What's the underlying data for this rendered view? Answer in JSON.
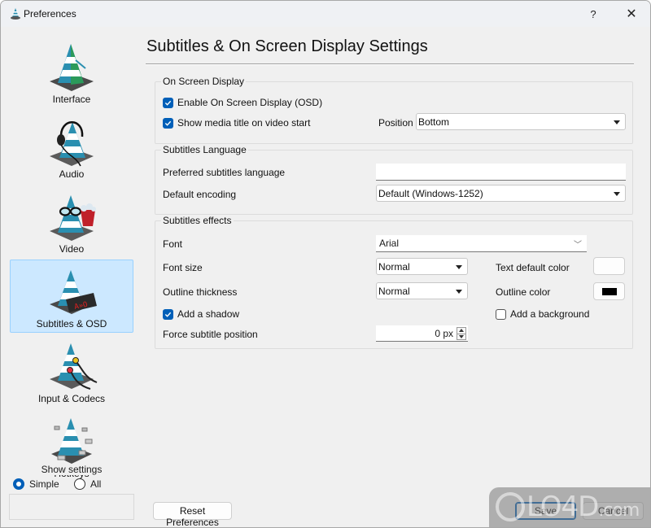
{
  "window": {
    "title": "Preferences",
    "help_label": "?",
    "close_label": "✕"
  },
  "sidebar": {
    "items": [
      {
        "label": "Interface",
        "icon": "vlc-cone-interface-icon",
        "selected": false
      },
      {
        "label": "Audio",
        "icon": "vlc-cone-headphones-icon",
        "selected": false
      },
      {
        "label": "Video",
        "icon": "vlc-cone-glasses-popcorn-icon",
        "selected": false
      },
      {
        "label": "Subtitles & OSD",
        "icon": "vlc-cone-osd-display-icon",
        "selected": true
      },
      {
        "label": "Input & Codecs",
        "icon": "vlc-cone-cables-icon",
        "selected": false
      },
      {
        "label": "Hotkeys",
        "icon": "vlc-cone-keys-icon",
        "selected": false
      }
    ],
    "show_settings": {
      "title": "Show settings",
      "options": [
        {
          "label": "Simple",
          "checked": true
        },
        {
          "label": "All",
          "checked": false
        }
      ]
    }
  },
  "main": {
    "heading": "Subtitles & On Screen Display Settings",
    "osd": {
      "title": "On Screen Display",
      "enable_osd": {
        "label": "Enable On Screen Display (OSD)",
        "checked": true
      },
      "show_title": {
        "label": "Show media title on video start",
        "checked": true
      },
      "position_label": "Position",
      "position_value": "Bottom"
    },
    "language": {
      "title": "Subtitles Language",
      "preferred_label": "Preferred subtitles language",
      "preferred_value": "",
      "encoding_label": "Default encoding",
      "encoding_value": "Default (Windows-1252)"
    },
    "effects": {
      "title": "Subtitles effects",
      "font_label": "Font",
      "font_value": "Arial",
      "font_size_label": "Font size",
      "font_size_value": "Normal",
      "outline_label": "Outline thickness",
      "outline_value": "Normal",
      "text_color_label": "Text default color",
      "text_color": "#ffffff",
      "outline_color_label": "Outline color",
      "outline_color": "#000000",
      "shadow": {
        "label": "Add a shadow",
        "checked": true
      },
      "background": {
        "label": "Add a background",
        "checked": false
      },
      "force_position_label": "Force subtitle position",
      "force_position_value": "0 px"
    }
  },
  "footer": {
    "reset_label": "Reset Preferences",
    "save_label": "Save",
    "cancel_label": "Cancel"
  },
  "watermark": {
    "text": "LO4D",
    "suffix": ".com"
  },
  "colors": {
    "accent": "#005fb8",
    "selected_bg": "#cce8ff",
    "window_bg": "#f0f0f0"
  }
}
